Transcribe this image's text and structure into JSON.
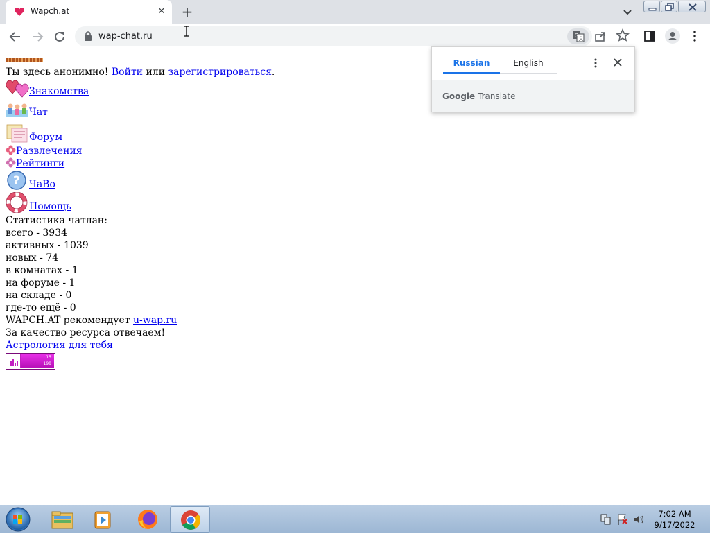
{
  "browser": {
    "tab_title": "Wapch.at",
    "tab_close": "✕",
    "new_tab": "+",
    "url": "wap-chat.ru"
  },
  "page": {
    "guest_prefix": "Ты здесь анонимно! ",
    "login_link": "Войти",
    "or_text": " или ",
    "register_link": "зарегистрироваться",
    "period": ".",
    "menu": [
      {
        "label": "Знакомства",
        "icon": "hearts-icon"
      },
      {
        "label": "Чат",
        "icon": "chat-people-icon"
      },
      {
        "label": "Форум",
        "icon": "forum-notes-icon"
      },
      {
        "label": "Развлечения",
        "icon": "flower-icon"
      },
      {
        "label": "Рейтинги",
        "icon": "flower-icon"
      },
      {
        "label": "ЧаВо",
        "icon": "question-icon"
      },
      {
        "label": "Помощь",
        "icon": "lifebuoy-icon"
      }
    ],
    "stats_title": "Статистика чатлан:",
    "stats": [
      "всего - 3934",
      "активных - 1039",
      "новых - 74",
      "в комнатах - 1",
      "на форуме - 1",
      "на складе - 0",
      "где-то ещё - 0"
    ],
    "recommend_prefix": "WAPCH.AT рекомендует ",
    "recommend_link": "u-wap.ru",
    "quality_text": "За качество ресурса отвечаем!",
    "astrology_link": "Астрология для тебя",
    "counter_top": "15",
    "counter_bottom": "198"
  },
  "translate_popup": {
    "tab_source": "Russian",
    "tab_target": "English",
    "brand_google": "Google",
    "brand_translate": " Translate"
  },
  "taskbar": {
    "time": "7:02 AM",
    "date": "9/17/2022"
  },
  "colors": {
    "link": "#0000ee",
    "translate_accent": "#1a73e8",
    "counter_accent": "#cc22cc"
  }
}
